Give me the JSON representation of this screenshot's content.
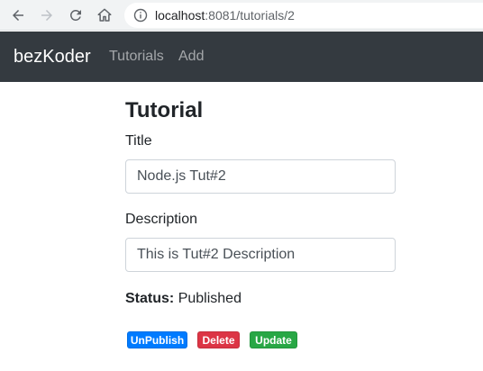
{
  "browser": {
    "url_host": "localhost",
    "url_rest": ":8081/tutorials/2"
  },
  "navbar": {
    "brand": "bezKoder",
    "links": [
      "Tutorials",
      "Add"
    ]
  },
  "form": {
    "heading": "Tutorial",
    "title_label": "Title",
    "title_value": "Node.js Tut#2",
    "description_label": "Description",
    "description_value": "This is Tut#2 Description",
    "status_label": "Status:",
    "status_value": "Published"
  },
  "actions": {
    "unpublish_label": "UnPublish",
    "delete_label": "Delete",
    "update_label": "Update"
  },
  "colors": {
    "navbar_bg": "#343a40",
    "unpublish": "#007bff",
    "delete": "#dc3545",
    "update": "#28a745"
  }
}
